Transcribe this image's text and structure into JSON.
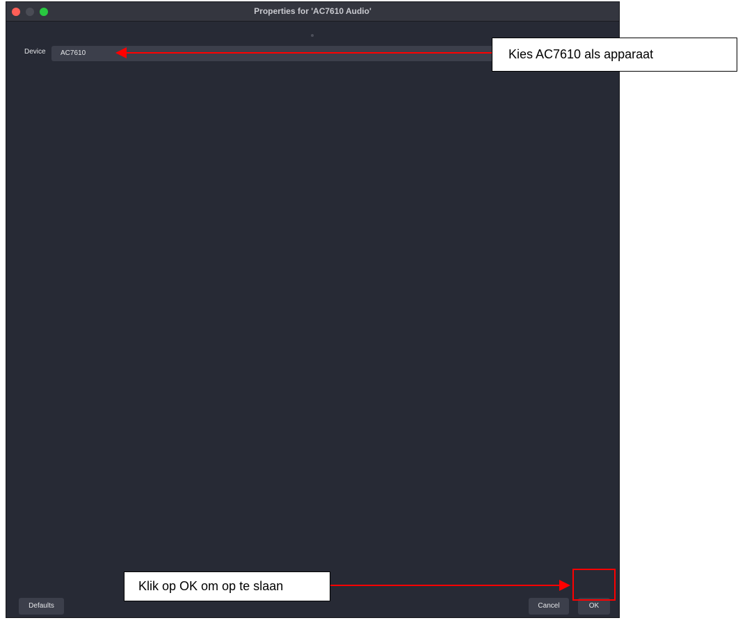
{
  "window": {
    "title": "Properties for 'AC7610 Audio'"
  },
  "form": {
    "device_label": "Device",
    "device_value": "AC7610"
  },
  "buttons": {
    "defaults": "Defaults",
    "cancel": "Cancel",
    "ok": "OK"
  },
  "annotations": {
    "device_callout": "Kies AC7610 als apparaat",
    "ok_callout": "Klik op OK om op te slaan",
    "arrow_color": "#ff0000"
  },
  "colors": {
    "window_bg": "#272a35",
    "control_bg": "#3c3f4b",
    "close": "#ff5f57",
    "zoom": "#28c840"
  }
}
